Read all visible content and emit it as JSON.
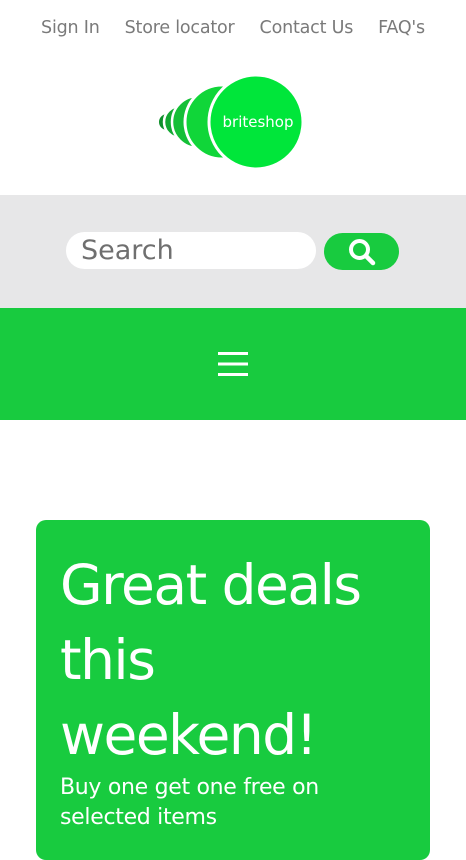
{
  "top_nav": {
    "items": [
      "Sign In",
      "Store locator",
      "Contact Us",
      "FAQ's"
    ]
  },
  "logo": {
    "text": "briteshop",
    "icon": "layered-circles-logo"
  },
  "search": {
    "placeholder": "Search",
    "button_icon": "search-icon"
  },
  "menu": {
    "icon": "hamburger-icon"
  },
  "promo": {
    "title": "Great deals this weekend!",
    "subtitle": "Buy one get one free on selected items"
  },
  "colors": {
    "brand_green": "#18cb3f",
    "logo_green": "#00e63a",
    "search_band": "#e7e7e8",
    "nav_text": "#7a7a7a"
  }
}
